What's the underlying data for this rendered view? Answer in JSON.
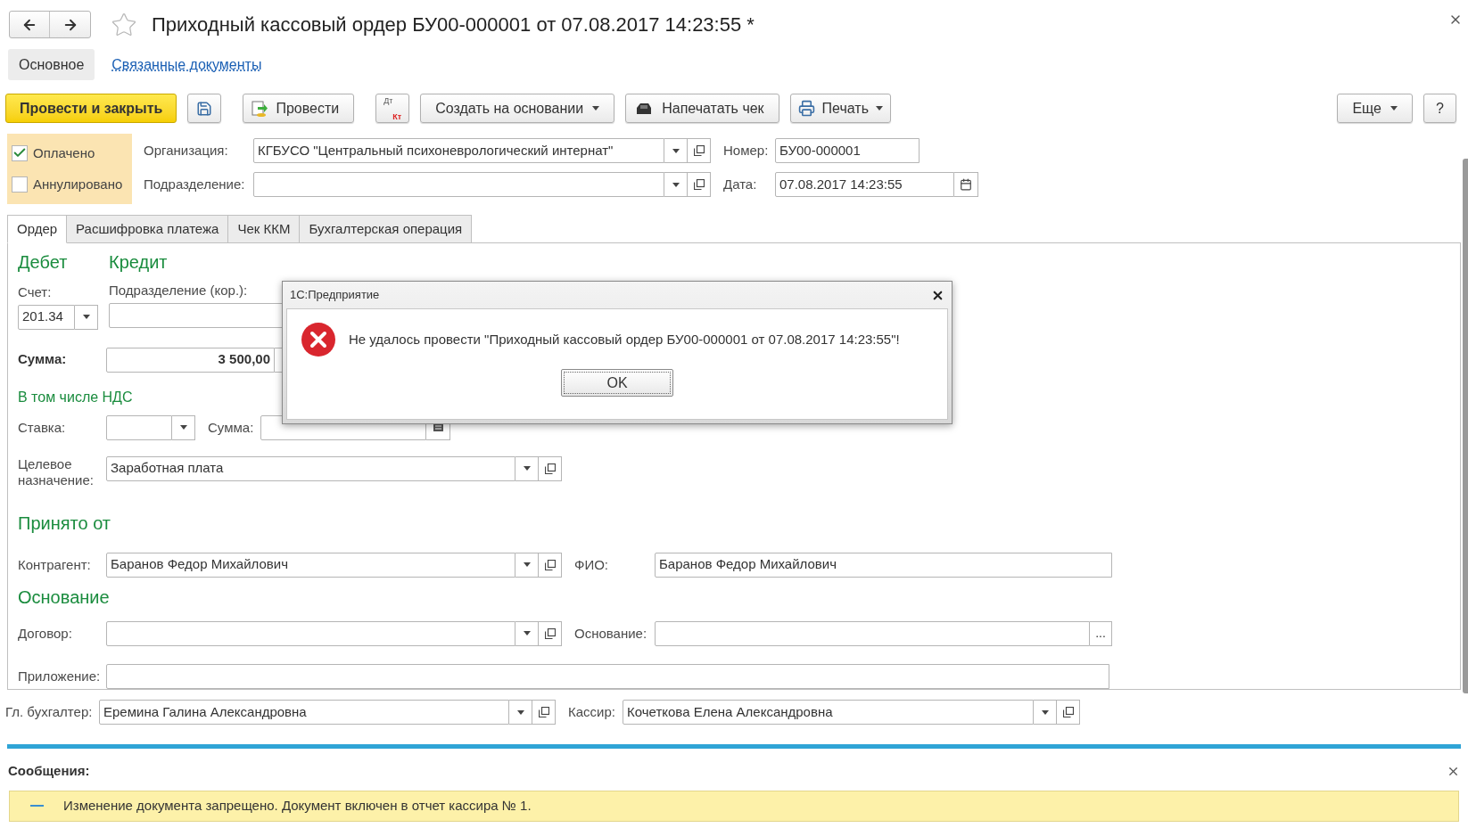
{
  "window": {
    "title": "Приходный кассовый ордер БУ00-000001 от 07.08.2017 14:23:55 *"
  },
  "sections": [
    {
      "label": "Основное",
      "selected": true
    },
    {
      "label": "Связанные документы",
      "selected": false
    }
  ],
  "toolbar": [
    {
      "kind": "primary",
      "label": "Провести и закрыть"
    },
    {
      "kind": "save"
    },
    {
      "kind": "post",
      "label": "Провести"
    },
    {
      "kind": "dtkt",
      "top": "Дт",
      "bottom": "Кт"
    },
    {
      "kind": "menu",
      "label": "Создать на основании"
    },
    {
      "kind": "receipt",
      "label": "Напечатать чек"
    },
    {
      "kind": "print",
      "label": "Печать"
    }
  ],
  "toolbar_right": [
    {
      "kind": "menu",
      "label": "Еще"
    },
    {
      "kind": "help",
      "label": "?"
    }
  ],
  "flags": [
    {
      "label": "Оплачено",
      "checked": true
    },
    {
      "label": "Аннулировано",
      "checked": false
    }
  ],
  "header": {
    "organization": {
      "label": "Организация:",
      "value": "КГБУСО \"Центральный психоневрологический интернат\""
    },
    "subdivision": {
      "label": "Подразделение:"
    },
    "number": {
      "label": "Номер:",
      "value": "БУ00-000001"
    },
    "date": {
      "label": "Дата:",
      "value": "07.08.2017 14:23:55"
    }
  },
  "tabs": [
    {
      "label": "Ордер",
      "selected": true
    },
    {
      "label": "Расшифровка платежа",
      "selected": false
    },
    {
      "label": "Чек ККМ",
      "selected": false
    },
    {
      "label": "Бухгалтерская операция",
      "selected": false
    }
  ],
  "order": {
    "debit": "Дебет",
    "credit": "Кредит",
    "account": {
      "label": "Счет:",
      "value": "201.34"
    },
    "subdivision_kor": {
      "label": "Подразделение (кор.):"
    },
    "sum": {
      "label": "Сумма:",
      "value": "3 500,00"
    },
    "vat_heading": "В том числе НДС",
    "rate": {
      "label": "Ставка:"
    },
    "vat_sum": {
      "label": "Сумма:"
    },
    "purpose": {
      "label": "Целевое назначение:",
      "value": "Заработная плата"
    },
    "received_heading": "Принято от",
    "counterparty": {
      "label": "Контрагент:",
      "value": "Баранов Федор Михайлович"
    },
    "fio": {
      "label": "ФИО:",
      "value": "Баранов Федор Михайлович"
    },
    "basis_heading": "Основание",
    "contract": {
      "label": "Договор:"
    },
    "basis": {
      "label": "Основание:",
      "button": "..."
    },
    "attachment": {
      "label": "Приложение:"
    }
  },
  "footer": {
    "chief": {
      "label": "Гл. бухгалтер:",
      "value": "Еремина Галина Александровна"
    },
    "cashier": {
      "label": "Кассир:",
      "value": "Кочеткова Елена Александровна"
    }
  },
  "dialog": {
    "title": "1С:Предприятие",
    "message": "Не удалось провести \"Приходный кассовый ордер БУ00-000001 от 07.08.2017 14:23:55\"!",
    "button": "OK"
  },
  "messages": {
    "title": "Сообщения:",
    "items": [
      {
        "text": "Изменение документа запрещено. Документ включен в отчет кассира № 1."
      }
    ]
  }
}
